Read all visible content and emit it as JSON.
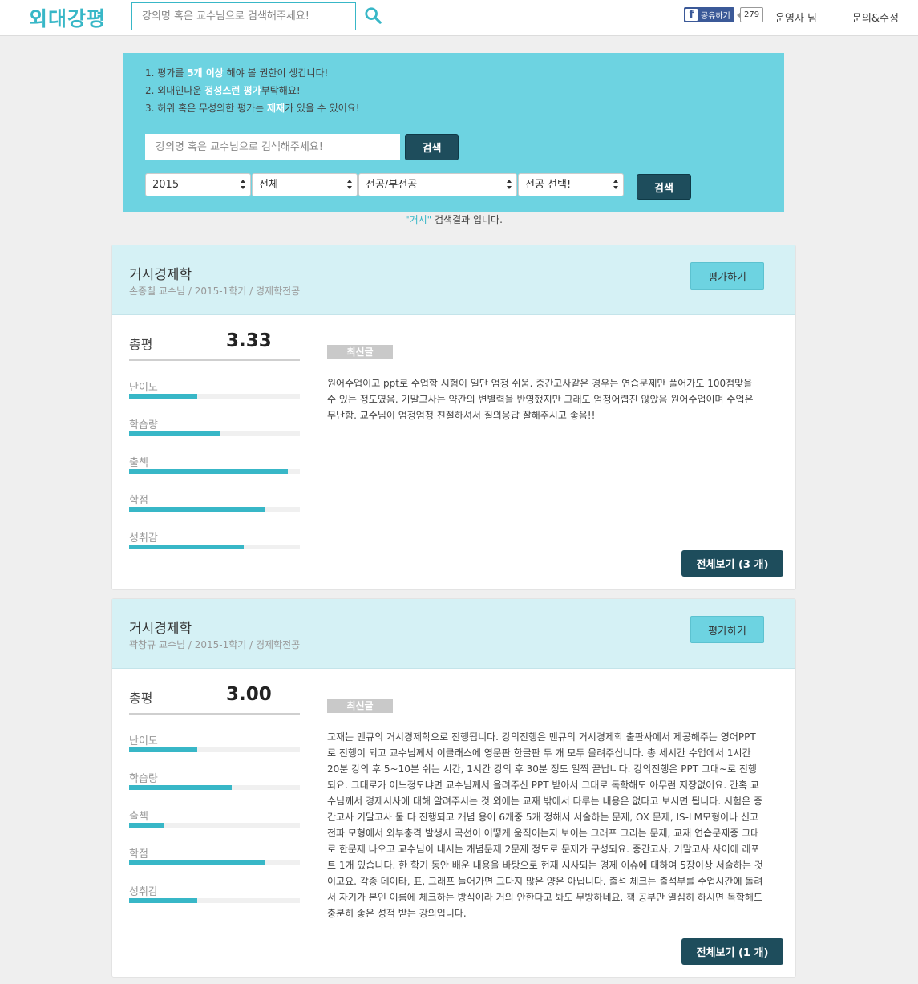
{
  "header": {
    "logo": "외대강평",
    "search_placeholder": "강의명 혹은 교수님으로 검색해주세요!",
    "fb_share_label": "공유하기",
    "fb_share_count": "279",
    "user_label": "운영자 님",
    "contact_label": "문의&수정"
  },
  "notice": {
    "line1_pre": "1. 평가를 ",
    "line1_bold": "5개 이상",
    "line1_post": " 해야 볼 권한이 생깁니다!",
    "line2_pre": "2. 외대인다운 ",
    "line2_bold": "정성스런 평가",
    "line2_post": "부탁해요!",
    "line3_pre": "3. 허위 혹은 무성의한 평가는 ",
    "line3_bold": "제재",
    "line3_post": "가 있을 수 있어요!"
  },
  "search_panel": {
    "placeholder": "강의명 혹은 교수님으로 검색해주세요!",
    "search_button": "검색",
    "year_select": "2015",
    "type_select": "전체",
    "major_type_select": "전공/부전공",
    "major_select": "전공 선택!",
    "filter_button": "검색"
  },
  "result_note": {
    "keyword": "\"거시\"",
    "text": " 검색결과 입니다."
  },
  "courses": [
    {
      "title": "거시경제학",
      "meta": "손종칠 교수님 / 2015-1학기 / 경제학전공",
      "rate_button": "평가하기",
      "total_label": "총평",
      "total_score": "3.33",
      "metrics": [
        {
          "label": "난이도",
          "value": 0.4
        },
        {
          "label": "학습량",
          "value": 0.53
        },
        {
          "label": "출첵",
          "value": 0.93
        },
        {
          "label": "학점",
          "value": 0.8
        },
        {
          "label": "성취감",
          "value": 0.67
        }
      ],
      "badge": "최신글",
      "review": "원어수업이고 ppt로 수업함 시험이 일단 엄청 쉬움. 중간고사같은 경우는 연습문제만 풀어가도 100점맞을 수 있는 정도였음. 기말고사는 약간의 변별력을 반영했지만 그래도 엄청어렵진 않았음 원어수업이며 수업은 무난함. 교수님이 엄청엄청 친절하셔서 질의응답 잘해주시고 좋음!!",
      "view_all": "전체보기 (3 개)"
    },
    {
      "title": "거시경제학",
      "meta": "곽창규 교수님 / 2015-1학기 / 경제학전공",
      "rate_button": "평가하기",
      "total_label": "총평",
      "total_score": "3.00",
      "metrics": [
        {
          "label": "난이도",
          "value": 0.4
        },
        {
          "label": "학습량",
          "value": 0.6
        },
        {
          "label": "출첵",
          "value": 0.2
        },
        {
          "label": "학점",
          "value": 0.8
        },
        {
          "label": "성취감",
          "value": 0.4
        }
      ],
      "badge": "최신글",
      "review": "교재는 맨큐의 거시경제학으로 진행됩니다. 강의진행은 맨큐의 거시경제학 출판사에서 제공해주는 영어PPT로 진행이 되고 교수님께서 이클래스에 영문판 한글판 두 개 모두 올려주십니다. 총 세시간 수업에서 1시간 20분 강의 후 5~10분 쉬는 시간, 1시간 강의 후 30분 정도 일찍 끝납니다. 강의진행은 PPT 그대~로 진행되요. 그대로가 어느정도냐면 교수님께서 올려주신 PPT 받아서 그대로 독학해도 아무런 지장없어요. 간혹 교수님께서 경제시사에 대해 알려주시는 것 외에는 교재 밖에서 다루는 내용은 없다고 보시면 됩니다. 시험은 중간고사 기말고사 둘 다 진행되고 개념 용어 6개중 5개 정해서 서술하는 문제, OX 문제, IS-LM모형이나 신고전파 모형에서 외부충격 발생시 곡선이 어떻게 움직이는지 보이는 그래프 그리는 문제, 교재 연습문제중 그대로 한문제 나오고 교수님이 내시는 개념문제 2문제 정도로 문제가 구성되요. 중간고사, 기말고사 사이에 레포트 1개 있습니다. 한 학기 동안 배운 내용을 바탕으로 현재 시사되는 경제 이슈에 대하여 5장이상 서술하는 것이고요. 각종 데이타, 표, 그래프 들어가면 그다지 많은 양은 아닙니다. 출석 체크는 출석부를 수업시간에 돌려서 자기가 본인 이름에 체크하는 방식이라 거의 안한다고 봐도 무방하네요. 책 공부만 열심히 하시면 독학해도 충분히 좋은 성적 받는 강의입니다.",
      "view_all": "전체보기 (1 개)"
    }
  ],
  "colors": {
    "brand": "#38b7c7",
    "panel": "#6dd3e1",
    "dark_button": "#1e4d5c",
    "card_head": "#d5f1f5"
  }
}
